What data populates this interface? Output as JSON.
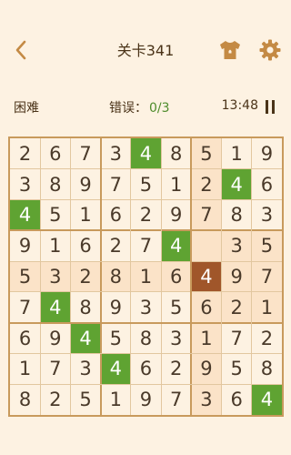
{
  "header": {
    "back_icon": "chevron-left-icon",
    "title": "关卡341",
    "theme_icon": "shirt-icon",
    "settings_icon": "gear-icon"
  },
  "status": {
    "difficulty": "困难",
    "errors_label": "错误：",
    "errors_value": "0/3",
    "timer": "13:48",
    "pause_icon": "pause-icon"
  },
  "colors": {
    "background": "#fdf2e2",
    "accent": "#c89a5c",
    "text": "#4a3318",
    "correct_cell": "#5fa332",
    "selected_cell": "#a0562a",
    "highlight_cell": "#fbe3c8"
  },
  "board": {
    "rows": [
      [
        "2",
        "6",
        "7",
        "3",
        "4",
        "8",
        "5",
        "1",
        "9"
      ],
      [
        "3",
        "8",
        "9",
        "7",
        "5",
        "1",
        "2",
        "4",
        "6"
      ],
      [
        "4",
        "5",
        "1",
        "6",
        "2",
        "9",
        "7",
        "8",
        "3"
      ],
      [
        "9",
        "1",
        "6",
        "2",
        "7",
        "4",
        "",
        "3",
        "5"
      ],
      [
        "5",
        "3",
        "2",
        "8",
        "1",
        "6",
        "4",
        "9",
        "7"
      ],
      [
        "7",
        "4",
        "8",
        "9",
        "3",
        "5",
        "6",
        "2",
        "1"
      ],
      [
        "6",
        "9",
        "4",
        "5",
        "8",
        "3",
        "1",
        "7",
        "2"
      ],
      [
        "1",
        "7",
        "3",
        "4",
        "6",
        "2",
        "9",
        "5",
        "8"
      ],
      [
        "8",
        "2",
        "5",
        "1",
        "9",
        "7",
        "3",
        "6",
        "4"
      ]
    ],
    "selected": [
      4,
      6
    ],
    "green_cells": [
      [
        0,
        4
      ],
      [
        1,
        7
      ],
      [
        2,
        0
      ],
      [
        3,
        5
      ],
      [
        5,
        1
      ],
      [
        6,
        2
      ],
      [
        7,
        3
      ],
      [
        8,
        8
      ]
    ]
  }
}
